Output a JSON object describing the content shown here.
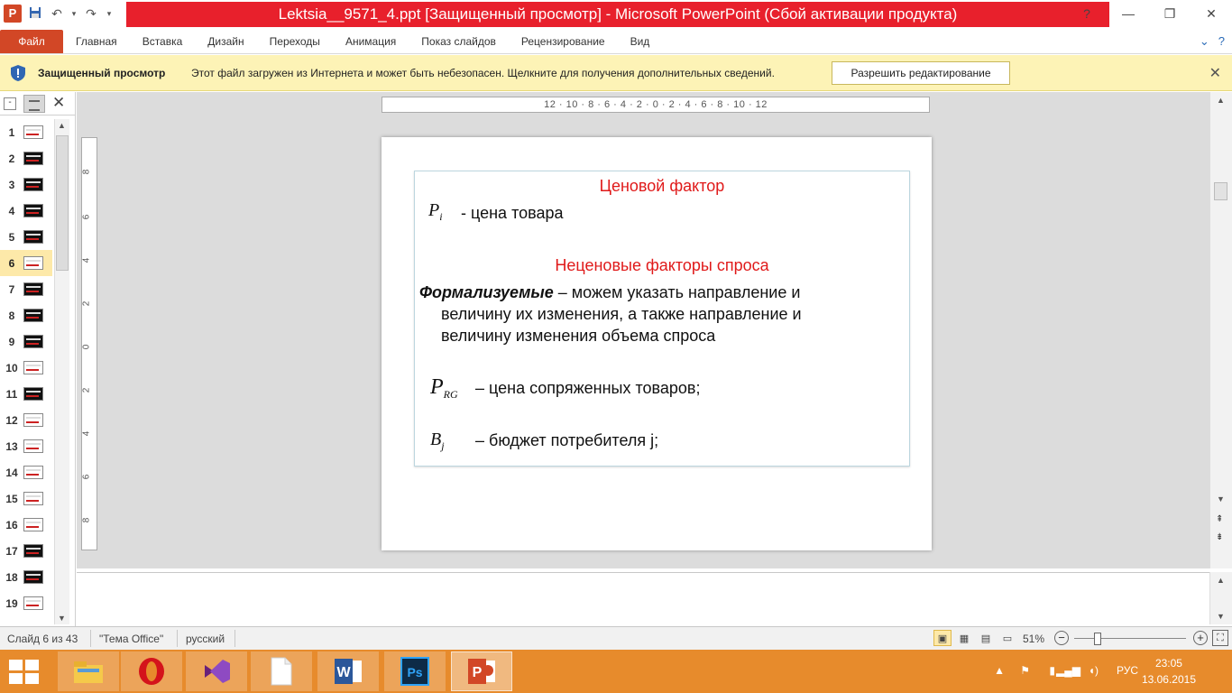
{
  "window": {
    "title": "Lektsia__9571_4.ppt [Защищенный просмотр] - Microsoft PowerPoint (Сбой активации продукта)",
    "app_letter": "P"
  },
  "ribbon": {
    "file_tab": "Файл",
    "tabs": [
      "Главная",
      "Вставка",
      "Дизайн",
      "Переходы",
      "Анимация",
      "Показ слайдов",
      "Рецензирование",
      "Вид"
    ]
  },
  "protected_view": {
    "title": "Защищенный просмотр",
    "message": "Этот файл загружен из Интернета и может быть небезопасен. Щелкните для получения дополнительных сведений.",
    "button": "Разрешить редактирование"
  },
  "slides_pane": {
    "numbers": [
      "1",
      "2",
      "3",
      "4",
      "5",
      "6",
      "7",
      "8",
      "9",
      "10",
      "11",
      "12",
      "13",
      "14",
      "15",
      "16",
      "17",
      "18",
      "19"
    ],
    "active": "6"
  },
  "ruler": {
    "horizontal": "12 · 10 · 8 · 6 · 4 · 2 · 0 · 2 · 4 · 6 · 8 · 10 · 12",
    "vertical": [
      "8",
      "6",
      "4",
      "2",
      "0",
      "2",
      "4",
      "6",
      "8"
    ]
  },
  "slide": {
    "price_title": "Ценовой фактор",
    "p_i_symbol": "P",
    "p_i_sub": "i",
    "price_desc": "- цена товара",
    "nonprice_title": "Неценовые факторы спроса",
    "formal_bold": "Формализуемые",
    "formal_line1": " – можем указать направление и",
    "formal_line2": "величину их изменения, а также направление и",
    "formal_line3": "величину изменения объема спроса",
    "p_rg_symbol": "P",
    "p_rg_sub": "RG",
    "p_rg_desc": "– цена сопряженных товаров;",
    "b_j_symbol": "B",
    "b_j_sub": "j",
    "b_j_desc": "– бюджет потребителя j;"
  },
  "status": {
    "slide_info": "Слайд 6 из 43",
    "theme": "\"Тема Office\"",
    "language": "русский",
    "zoom": "51%"
  },
  "taskbar": {
    "lang": "РУС",
    "time": "23:05",
    "date": "13.06.2015"
  },
  "colors": {
    "title_bar": "#e8202c",
    "accent": "#d24726",
    "slide_red": "#e01a1a",
    "taskbar": "#e78b2c",
    "protected_bar": "#fdf3b6"
  }
}
